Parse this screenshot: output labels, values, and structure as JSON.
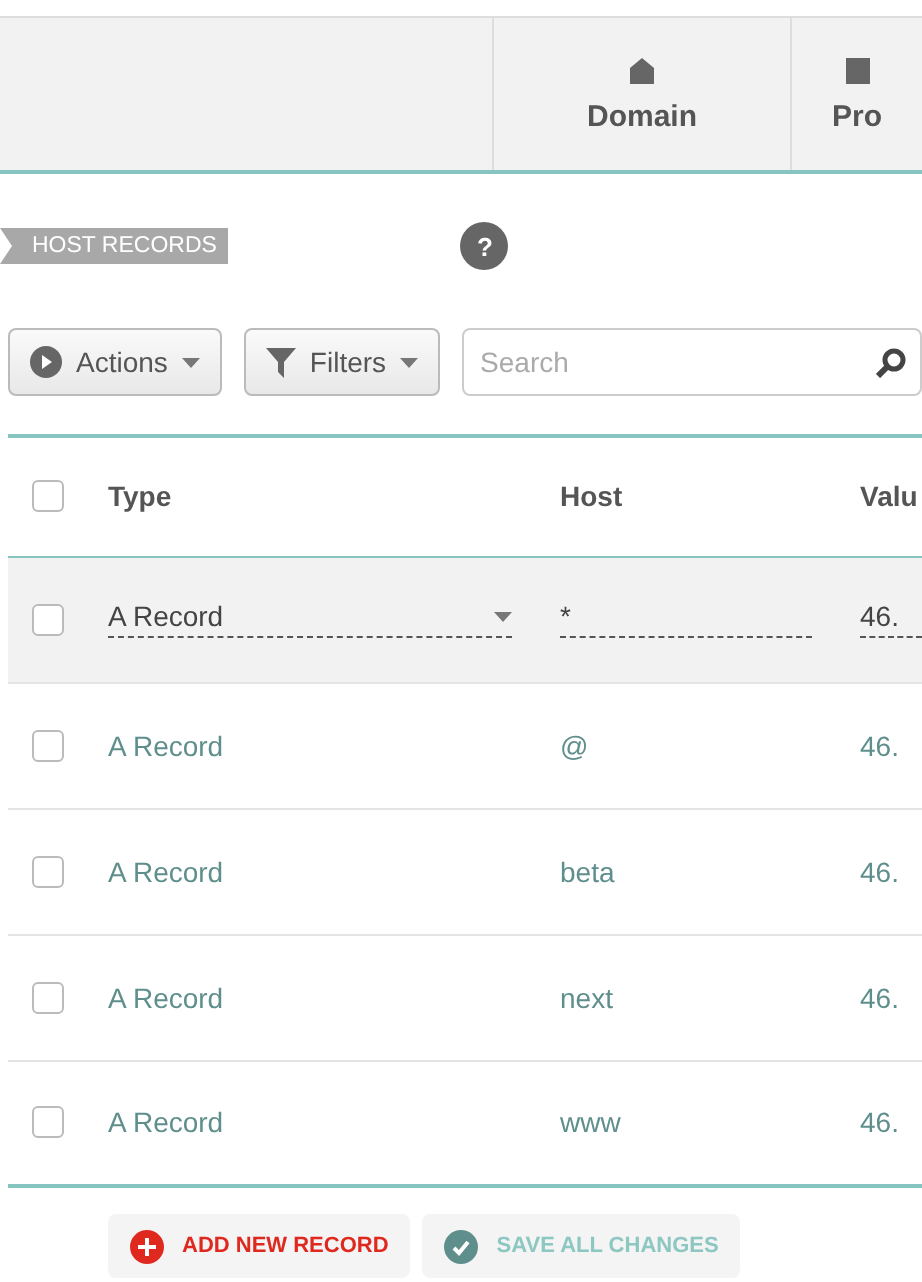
{
  "tabs": [
    {
      "label": "Domain",
      "selected": false
    },
    {
      "label": "Pro",
      "selected": false
    }
  ],
  "section_label": "HOST RECORDS",
  "help": "?",
  "toolbar": {
    "actions": "Actions",
    "filters": "Filters",
    "search": {
      "placeholder": "Search"
    }
  },
  "table": {
    "header_checked": false,
    "columns": [
      "Type",
      "Host",
      "Valu"
    ],
    "rows": [
      {
        "checked": false,
        "editing": true,
        "type": "A Record",
        "host": "*",
        "value": "46."
      },
      {
        "checked": false,
        "editing": false,
        "type": "A Record",
        "host": "@",
        "value": "46."
      },
      {
        "checked": false,
        "editing": false,
        "type": "A Record",
        "host": "beta",
        "value": "46."
      },
      {
        "checked": false,
        "editing": false,
        "type": "A Record",
        "host": "next",
        "value": "46."
      },
      {
        "checked": false,
        "editing": false,
        "type": "A Record",
        "host": "www",
        "value": "46."
      }
    ]
  },
  "buttons": [
    {
      "kind": "add",
      "label": "ADD NEW RECORD"
    },
    {
      "kind": "save",
      "label": "SAVE ALL CHANGES"
    }
  ]
}
